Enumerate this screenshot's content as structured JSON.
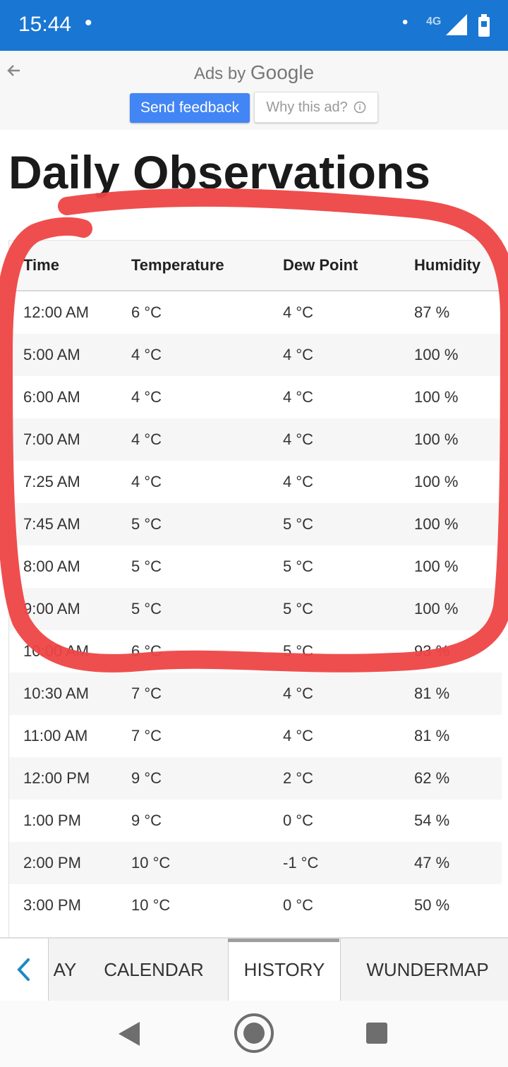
{
  "status_bar": {
    "time": "15:44",
    "dot": "•",
    "dot2": "•",
    "network": "4G"
  },
  "ad": {
    "ads_by": "Ads by",
    "google": "Google",
    "send_feedback": "Send feedback",
    "why_this_ad": "Why this ad?"
  },
  "page": {
    "title": "Daily Observations"
  },
  "table": {
    "headers": [
      "Time",
      "Temperature",
      "Dew Point",
      "Humidity"
    ],
    "rows": [
      [
        "12:00 AM",
        "6 °C",
        "4 °C",
        "87 %"
      ],
      [
        "5:00 AM",
        "4 °C",
        "4 °C",
        "100 %"
      ],
      [
        "6:00 AM",
        "4 °C",
        "4 °C",
        "100 %"
      ],
      [
        "7:00 AM",
        "4 °C",
        "4 °C",
        "100 %"
      ],
      [
        "7:25 AM",
        "4 °C",
        "4 °C",
        "100 %"
      ],
      [
        "7:45 AM",
        "5 °C",
        "5 °C",
        "100 %"
      ],
      [
        "8:00 AM",
        "5 °C",
        "5 °C",
        "100 %"
      ],
      [
        "9:00 AM",
        "5 °C",
        "5 °C",
        "100 %"
      ],
      [
        "10:00 AM",
        "6 °C",
        "5 °C",
        "93 %"
      ],
      [
        "10:30 AM",
        "7 °C",
        "4 °C",
        "81 %"
      ],
      [
        "11:00 AM",
        "7 °C",
        "4 °C",
        "81 %"
      ],
      [
        "12:00 PM",
        "9 °C",
        "2 °C",
        "62 %"
      ],
      [
        "1:00 PM",
        "9 °C",
        "0 °C",
        "54 %"
      ],
      [
        "2:00 PM",
        "10 °C",
        "-1 °C",
        "47 %"
      ],
      [
        "3:00 PM",
        "10 °C",
        "0 °C",
        "50 %"
      ]
    ]
  },
  "bottom_tabs": {
    "partial": "AY",
    "calendar": "CALENDAR",
    "history": "HISTORY",
    "wundermap": "WUNDERMAP"
  },
  "colors": {
    "status_bar": "#1976d2",
    "feedback_button": "#4285f4",
    "annotation": "#ee4444",
    "chevron": "#1e88c8"
  }
}
